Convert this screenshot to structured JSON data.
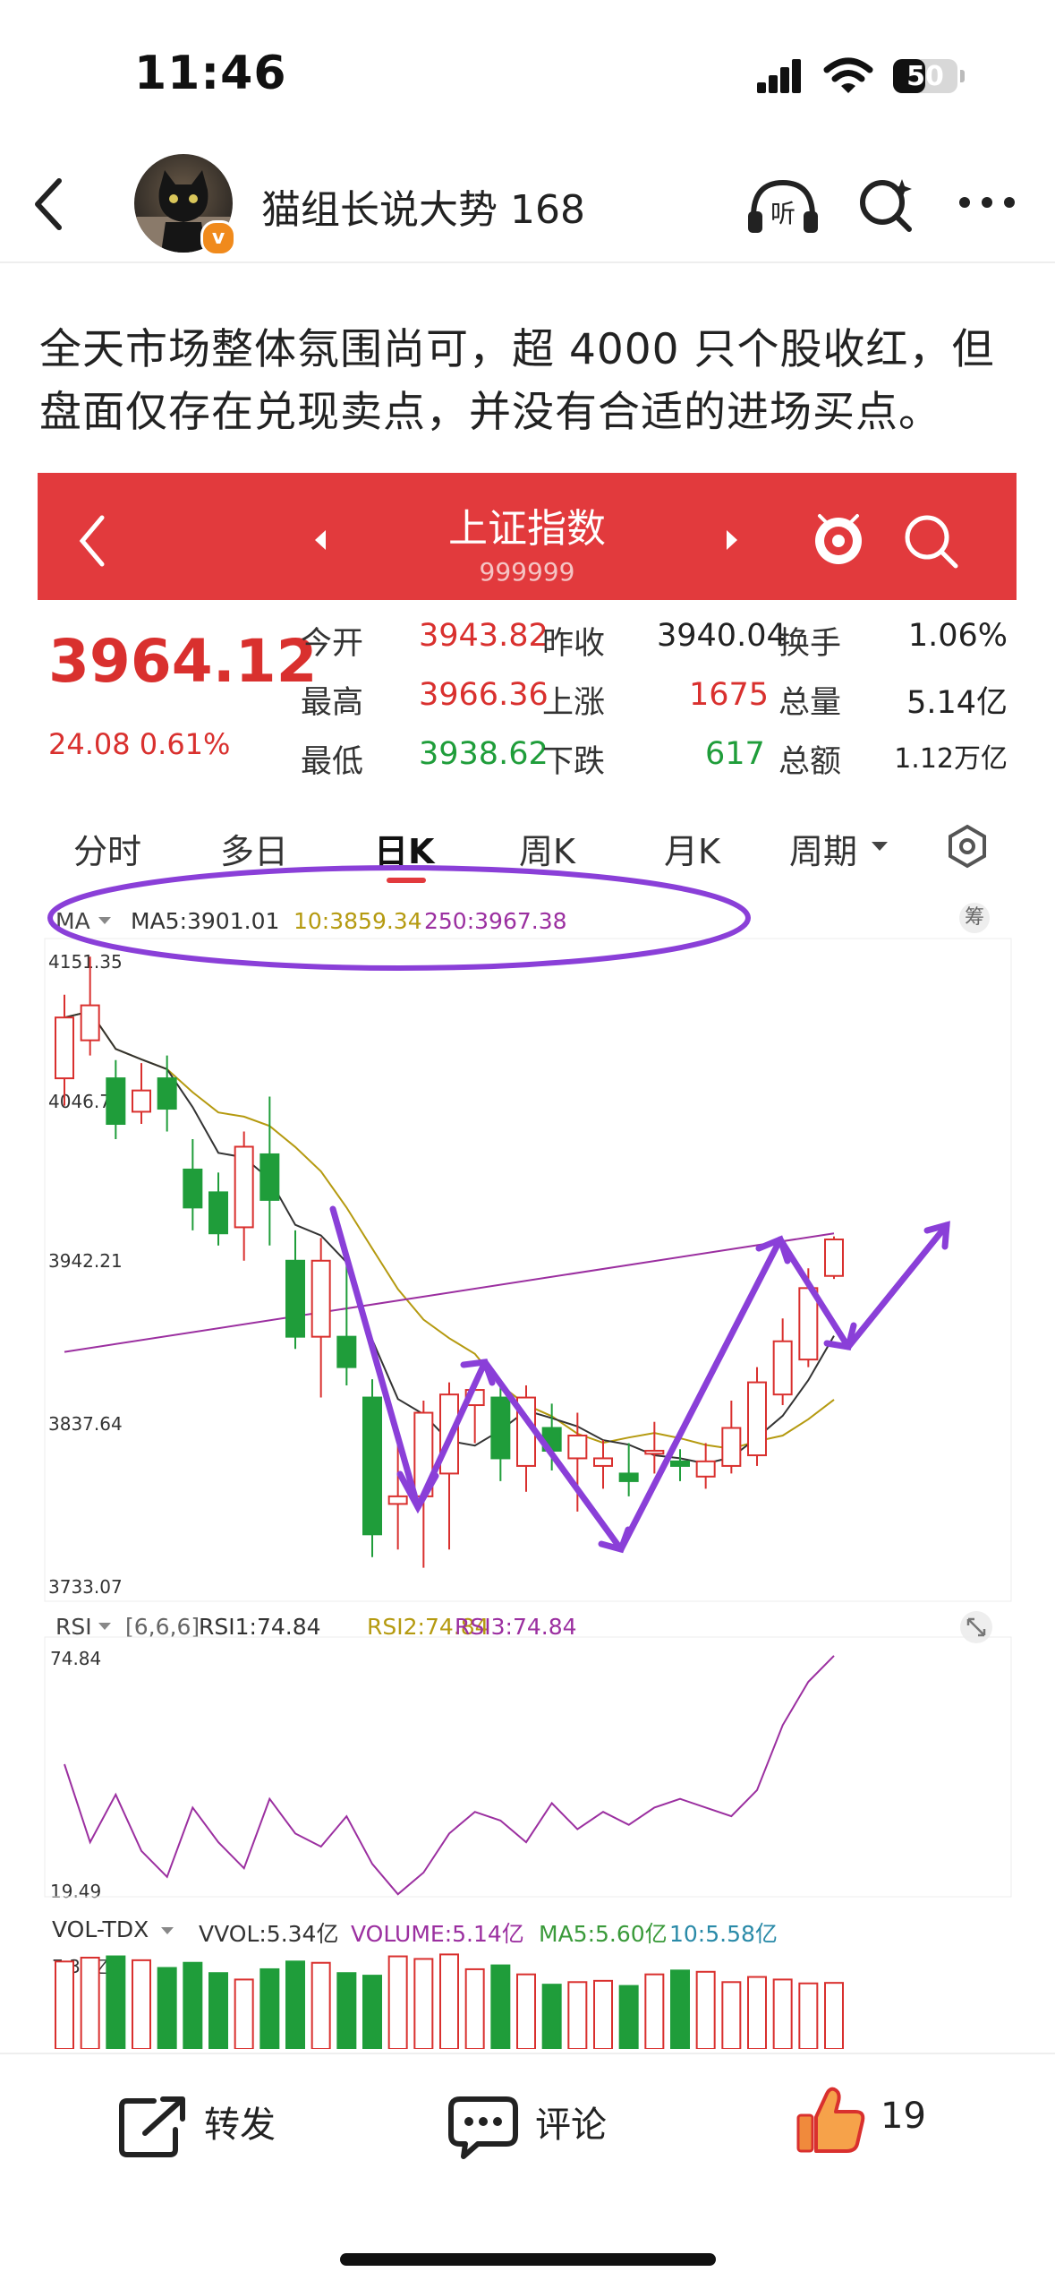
{
  "status_bar": {
    "time": "11:46",
    "battery": "50",
    "battery_level_percent": 50
  },
  "header": {
    "author": "猫组长说大势 168"
  },
  "post": {
    "text": "全天市场整体氛围尚可，超 4000 只个股收红，但盘面仅存在兑现卖点，并没有合适的进场买点。"
  },
  "stock": {
    "name": "上证指数",
    "code": "999999",
    "price": "3964.12",
    "change": "24.08 0.61%",
    "stats": [
      {
        "label": "今开",
        "value": "3943.82"
      },
      {
        "label": "昨收",
        "value": "3940.04"
      },
      {
        "label": "换手",
        "value": "1.06%"
      },
      {
        "label": "最高",
        "value": "3966.36"
      },
      {
        "label": "上涨",
        "value": "1675"
      },
      {
        "label": "总量",
        "value": "5.14亿"
      },
      {
        "label": "最低",
        "value": "3938.62"
      },
      {
        "label": "下跌",
        "value": "617"
      },
      {
        "label": "总额",
        "value": "1.12万亿"
      }
    ],
    "tabs": [
      "分时",
      "多日",
      "日K",
      "周K",
      "月K",
      "周期"
    ],
    "active_tab": "日K",
    "ma_indicator": {
      "name": "MA",
      "ma5": "MA5:3901.01",
      "ma10": "10:3859.34",
      "ma250": "250:3967.38",
      "fq": "筹"
    },
    "price_axis": [
      "4151.35",
      "4046.78",
      "3942.21",
      "3837.64",
      "3733.07"
    ],
    "rsi_indicator": {
      "name": "RSI",
      "params": "[6,6,6]",
      "rsi1": "RSI1:74.84",
      "rsi2": "RSI2:74.84",
      "rsi3": "RSI3:74.84",
      "max": "74.84",
      "min": "19.49"
    },
    "volume_indicator": {
      "name": "VOL-TDX",
      "vvol": "VVOL:5.34亿",
      "volume": "VOLUME:5.14亿",
      "ma5": "MA5:5.60亿",
      "ma10": "10:5.58亿",
      "max": "7.35亿"
    }
  },
  "chart_data": {
    "type": "candlestick",
    "ylim": [
      3733.07,
      4151.35
    ],
    "candles": [
      {
        "o": 4070,
        "c": 4110,
        "h": 4125,
        "l": 4052
      },
      {
        "o": 4095,
        "c": 4118,
        "h": 4150,
        "l": 4085
      },
      {
        "o": 4070,
        "c": 4040,
        "h": 4082,
        "l": 4030
      },
      {
        "o": 4048,
        "c": 4062,
        "h": 4080,
        "l": 4040
      },
      {
        "o": 4070,
        "c": 4050,
        "h": 4085,
        "l": 4035
      },
      {
        "o": 4010,
        "c": 3985,
        "h": 4030,
        "l": 3970
      },
      {
        "o": 3995,
        "c": 3968,
        "h": 4008,
        "l": 3960
      },
      {
        "o": 3972,
        "c": 4025,
        "h": 4035,
        "l": 3950
      },
      {
        "o": 4020,
        "c": 3990,
        "h": 4058,
        "l": 3960
      },
      {
        "o": 3950,
        "c": 3900,
        "h": 3970,
        "l": 3892
      },
      {
        "o": 3900,
        "c": 3950,
        "h": 3965,
        "l": 3860
      },
      {
        "o": 3900,
        "c": 3880,
        "h": 3955,
        "l": 3868
      },
      {
        "o": 3860,
        "c": 3770,
        "h": 3872,
        "l": 3755
      },
      {
        "o": 3790,
        "c": 3795,
        "h": 3830,
        "l": 3760
      },
      {
        "o": 3795,
        "c": 3850,
        "h": 3858,
        "l": 3748
      },
      {
        "o": 3810,
        "c": 3862,
        "h": 3870,
        "l": 3760
      },
      {
        "o": 3855,
        "c": 3865,
        "h": 3872,
        "l": 3830
      },
      {
        "o": 3860,
        "c": 3820,
        "h": 3868,
        "l": 3805
      },
      {
        "o": 3815,
        "c": 3860,
        "h": 3868,
        "l": 3798
      },
      {
        "o": 3840,
        "c": 3825,
        "h": 3856,
        "l": 3812
      },
      {
        "o": 3820,
        "c": 3835,
        "h": 3850,
        "l": 3785
      },
      {
        "o": 3815,
        "c": 3820,
        "h": 3832,
        "l": 3800
      },
      {
        "o": 3810,
        "c": 3805,
        "h": 3830,
        "l": 3795
      },
      {
        "o": 3823,
        "c": 3825,
        "h": 3844,
        "l": 3810
      },
      {
        "o": 3818,
        "c": 3815,
        "h": 3826,
        "l": 3805
      },
      {
        "o": 3808,
        "c": 3818,
        "h": 3830,
        "l": 3800
      },
      {
        "o": 3815,
        "c": 3840,
        "h": 3858,
        "l": 3810
      },
      {
        "o": 3822,
        "c": 3870,
        "h": 3880,
        "l": 3815
      },
      {
        "o": 3862,
        "c": 3897,
        "h": 3912,
        "l": 3855
      },
      {
        "o": 3885,
        "c": 3932,
        "h": 3945,
        "l": 3880
      },
      {
        "o": 3940,
        "c": 3964,
        "h": 3966,
        "l": 3938
      }
    ],
    "rsi": [
      48,
      30,
      41,
      28,
      22,
      38,
      30,
      24,
      40,
      32,
      29,
      36,
      25,
      18,
      23,
      32,
      37,
      35,
      30,
      39,
      33,
      37,
      34,
      38,
      40,
      38,
      36,
      42,
      57,
      67,
      73
    ],
    "volume": [
      6.8,
      7.1,
      7.2,
      6.9,
      6.3,
      6.7,
      5.9,
      5.4,
      6.2,
      6.8,
      6.7,
      5.9,
      5.7,
      7.2,
      7.0,
      7.35,
      6.2,
      6.5,
      5.8,
      5.0,
      5.2,
      5.3,
      4.9,
      5.8,
      6.1,
      6.0,
      5.2,
      5.6,
      5.4,
      5.1,
      5.14
    ]
  },
  "actions": {
    "forward": "转发",
    "comment": "评论",
    "likes": "19"
  }
}
